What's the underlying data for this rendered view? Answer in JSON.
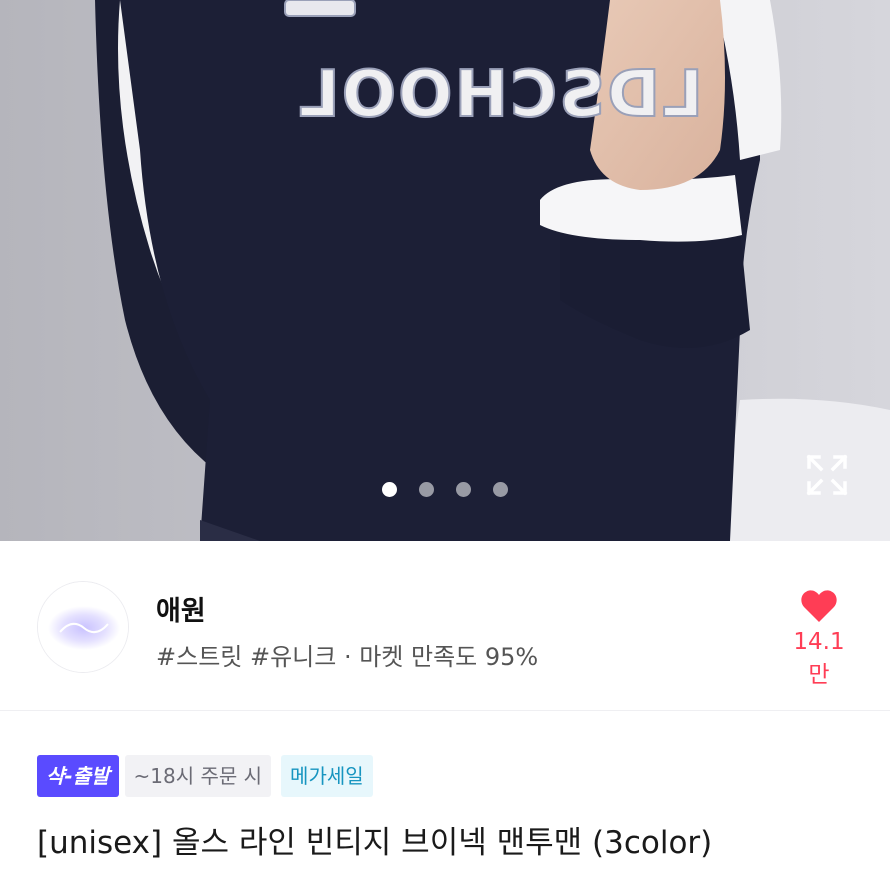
{
  "hero": {
    "print_text": "LDSCHOOL",
    "dots": [
      {
        "active": true
      },
      {
        "active": false
      },
      {
        "active": false
      },
      {
        "active": false
      }
    ],
    "expand_icon": "expand-icon"
  },
  "shop": {
    "name": "애원",
    "meta": "#스트릿 #유니크 · 마켓 만족도 95%",
    "logo_icon": "shop-logo",
    "like_count": "14.1만",
    "like_icon": "heart-icon",
    "like_color": "#ff3d55"
  },
  "badges": {
    "delivery": "샥-출발",
    "cutoff": "~18시 주문 시",
    "sale": "메가세일"
  },
  "product": {
    "title": "[unisex] 올스 라인 빈티지 브이넥 맨투맨 (3color)"
  },
  "colors": {
    "accent_purple": "#5a4bff",
    "sale_blue": "#1795c0",
    "heart_red": "#ff3d55"
  }
}
